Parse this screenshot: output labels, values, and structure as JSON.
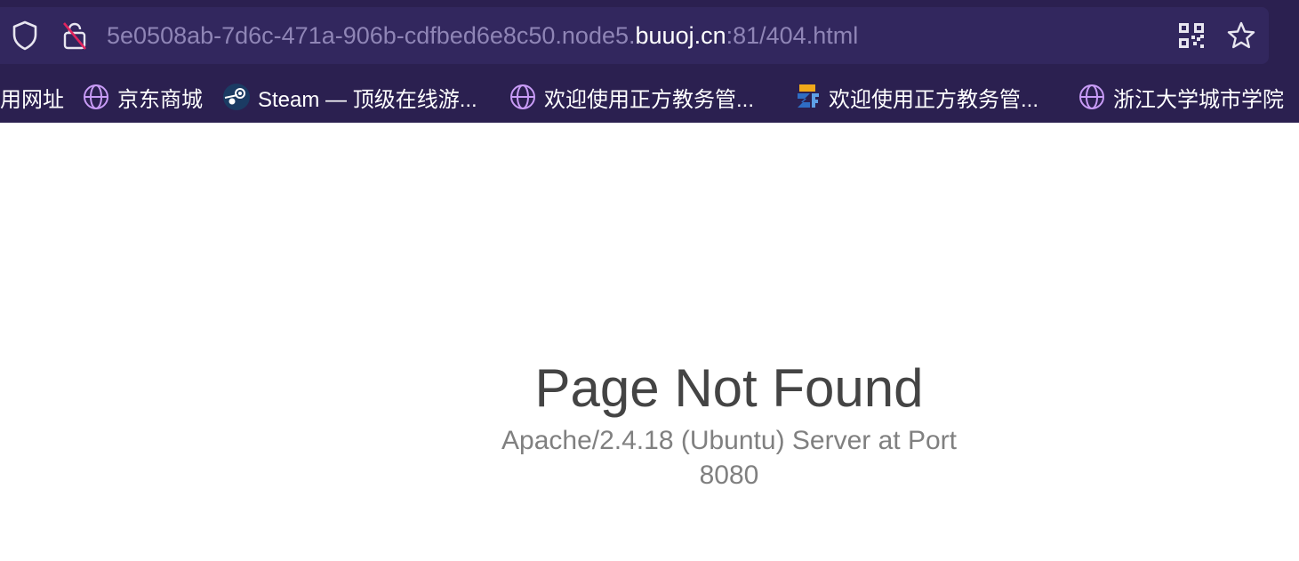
{
  "toolbar": {
    "url_path_prefix": "5e0508ab-7d6c-471a-906b-cdfbed6e8c50.node5.",
    "url_host": "buuoj.cn",
    "url_suffix": ":81/404.html"
  },
  "bookmarks": [
    {
      "label": "用网址",
      "icon": "none"
    },
    {
      "label": "京东商城",
      "icon": "globe-icon"
    },
    {
      "label": "Steam — 顶级在线游...",
      "icon": "steam-icon"
    },
    {
      "label": "欢迎使用正方教务管...",
      "icon": "globe-icon"
    },
    {
      "label": "欢迎使用正方教务管...",
      "icon": "zf-logo-icon"
    },
    {
      "label": "浙江大学城市学院",
      "icon": "globe-icon"
    }
  ],
  "page": {
    "title": "Page Not Found",
    "subtitle_line1": "Apache/2.4.18 (Ubuntu) Server at Port",
    "subtitle_line2": "8080"
  },
  "colors": {
    "toolbar_bg": "#2b2050",
    "urlbar_bg": "#32275e",
    "url_dim": "#8f85b6",
    "accent_globe": "#c89bf6"
  }
}
